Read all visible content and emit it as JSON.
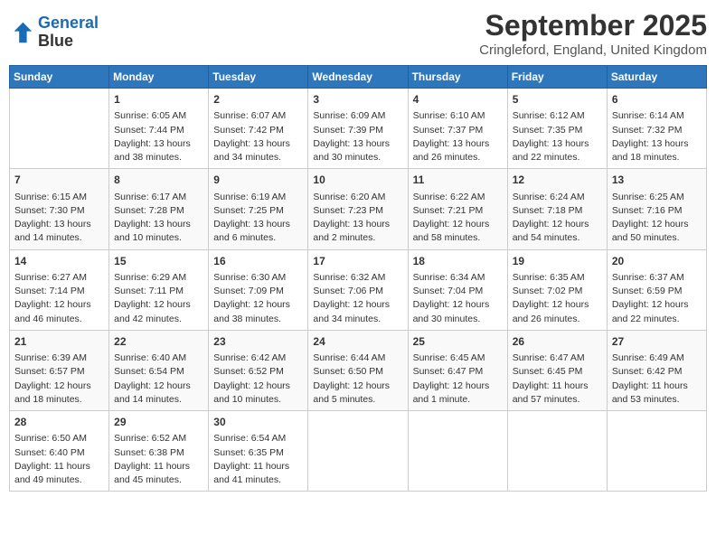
{
  "header": {
    "logo_line1": "General",
    "logo_line2": "Blue",
    "month_title": "September 2025",
    "location": "Cringleford, England, United Kingdom"
  },
  "days_of_week": [
    "Sunday",
    "Monday",
    "Tuesday",
    "Wednesday",
    "Thursday",
    "Friday",
    "Saturday"
  ],
  "weeks": [
    [
      {
        "day": "",
        "sunrise": "",
        "sunset": "",
        "daylight": ""
      },
      {
        "day": "1",
        "sunrise": "Sunrise: 6:05 AM",
        "sunset": "Sunset: 7:44 PM",
        "daylight": "Daylight: 13 hours and 38 minutes."
      },
      {
        "day": "2",
        "sunrise": "Sunrise: 6:07 AM",
        "sunset": "Sunset: 7:42 PM",
        "daylight": "Daylight: 13 hours and 34 minutes."
      },
      {
        "day": "3",
        "sunrise": "Sunrise: 6:09 AM",
        "sunset": "Sunset: 7:39 PM",
        "daylight": "Daylight: 13 hours and 30 minutes."
      },
      {
        "day": "4",
        "sunrise": "Sunrise: 6:10 AM",
        "sunset": "Sunset: 7:37 PM",
        "daylight": "Daylight: 13 hours and 26 minutes."
      },
      {
        "day": "5",
        "sunrise": "Sunrise: 6:12 AM",
        "sunset": "Sunset: 7:35 PM",
        "daylight": "Daylight: 13 hours and 22 minutes."
      },
      {
        "day": "6",
        "sunrise": "Sunrise: 6:14 AM",
        "sunset": "Sunset: 7:32 PM",
        "daylight": "Daylight: 13 hours and 18 minutes."
      }
    ],
    [
      {
        "day": "7",
        "sunrise": "Sunrise: 6:15 AM",
        "sunset": "Sunset: 7:30 PM",
        "daylight": "Daylight: 13 hours and 14 minutes."
      },
      {
        "day": "8",
        "sunrise": "Sunrise: 6:17 AM",
        "sunset": "Sunset: 7:28 PM",
        "daylight": "Daylight: 13 hours and 10 minutes."
      },
      {
        "day": "9",
        "sunrise": "Sunrise: 6:19 AM",
        "sunset": "Sunset: 7:25 PM",
        "daylight": "Daylight: 13 hours and 6 minutes."
      },
      {
        "day": "10",
        "sunrise": "Sunrise: 6:20 AM",
        "sunset": "Sunset: 7:23 PM",
        "daylight": "Daylight: 13 hours and 2 minutes."
      },
      {
        "day": "11",
        "sunrise": "Sunrise: 6:22 AM",
        "sunset": "Sunset: 7:21 PM",
        "daylight": "Daylight: 12 hours and 58 minutes."
      },
      {
        "day": "12",
        "sunrise": "Sunrise: 6:24 AM",
        "sunset": "Sunset: 7:18 PM",
        "daylight": "Daylight: 12 hours and 54 minutes."
      },
      {
        "day": "13",
        "sunrise": "Sunrise: 6:25 AM",
        "sunset": "Sunset: 7:16 PM",
        "daylight": "Daylight: 12 hours and 50 minutes."
      }
    ],
    [
      {
        "day": "14",
        "sunrise": "Sunrise: 6:27 AM",
        "sunset": "Sunset: 7:14 PM",
        "daylight": "Daylight: 12 hours and 46 minutes."
      },
      {
        "day": "15",
        "sunrise": "Sunrise: 6:29 AM",
        "sunset": "Sunset: 7:11 PM",
        "daylight": "Daylight: 12 hours and 42 minutes."
      },
      {
        "day": "16",
        "sunrise": "Sunrise: 6:30 AM",
        "sunset": "Sunset: 7:09 PM",
        "daylight": "Daylight: 12 hours and 38 minutes."
      },
      {
        "day": "17",
        "sunrise": "Sunrise: 6:32 AM",
        "sunset": "Sunset: 7:06 PM",
        "daylight": "Daylight: 12 hours and 34 minutes."
      },
      {
        "day": "18",
        "sunrise": "Sunrise: 6:34 AM",
        "sunset": "Sunset: 7:04 PM",
        "daylight": "Daylight: 12 hours and 30 minutes."
      },
      {
        "day": "19",
        "sunrise": "Sunrise: 6:35 AM",
        "sunset": "Sunset: 7:02 PM",
        "daylight": "Daylight: 12 hours and 26 minutes."
      },
      {
        "day": "20",
        "sunrise": "Sunrise: 6:37 AM",
        "sunset": "Sunset: 6:59 PM",
        "daylight": "Daylight: 12 hours and 22 minutes."
      }
    ],
    [
      {
        "day": "21",
        "sunrise": "Sunrise: 6:39 AM",
        "sunset": "Sunset: 6:57 PM",
        "daylight": "Daylight: 12 hours and 18 minutes."
      },
      {
        "day": "22",
        "sunrise": "Sunrise: 6:40 AM",
        "sunset": "Sunset: 6:54 PM",
        "daylight": "Daylight: 12 hours and 14 minutes."
      },
      {
        "day": "23",
        "sunrise": "Sunrise: 6:42 AM",
        "sunset": "Sunset: 6:52 PM",
        "daylight": "Daylight: 12 hours and 10 minutes."
      },
      {
        "day": "24",
        "sunrise": "Sunrise: 6:44 AM",
        "sunset": "Sunset: 6:50 PM",
        "daylight": "Daylight: 12 hours and 5 minutes."
      },
      {
        "day": "25",
        "sunrise": "Sunrise: 6:45 AM",
        "sunset": "Sunset: 6:47 PM",
        "daylight": "Daylight: 12 hours and 1 minute."
      },
      {
        "day": "26",
        "sunrise": "Sunrise: 6:47 AM",
        "sunset": "Sunset: 6:45 PM",
        "daylight": "Daylight: 11 hours and 57 minutes."
      },
      {
        "day": "27",
        "sunrise": "Sunrise: 6:49 AM",
        "sunset": "Sunset: 6:42 PM",
        "daylight": "Daylight: 11 hours and 53 minutes."
      }
    ],
    [
      {
        "day": "28",
        "sunrise": "Sunrise: 6:50 AM",
        "sunset": "Sunset: 6:40 PM",
        "daylight": "Daylight: 11 hours and 49 minutes."
      },
      {
        "day": "29",
        "sunrise": "Sunrise: 6:52 AM",
        "sunset": "Sunset: 6:38 PM",
        "daylight": "Daylight: 11 hours and 45 minutes."
      },
      {
        "day": "30",
        "sunrise": "Sunrise: 6:54 AM",
        "sunset": "Sunset: 6:35 PM",
        "daylight": "Daylight: 11 hours and 41 minutes."
      },
      {
        "day": "",
        "sunrise": "",
        "sunset": "",
        "daylight": ""
      },
      {
        "day": "",
        "sunrise": "",
        "sunset": "",
        "daylight": ""
      },
      {
        "day": "",
        "sunrise": "",
        "sunset": "",
        "daylight": ""
      },
      {
        "day": "",
        "sunrise": "",
        "sunset": "",
        "daylight": ""
      }
    ]
  ]
}
